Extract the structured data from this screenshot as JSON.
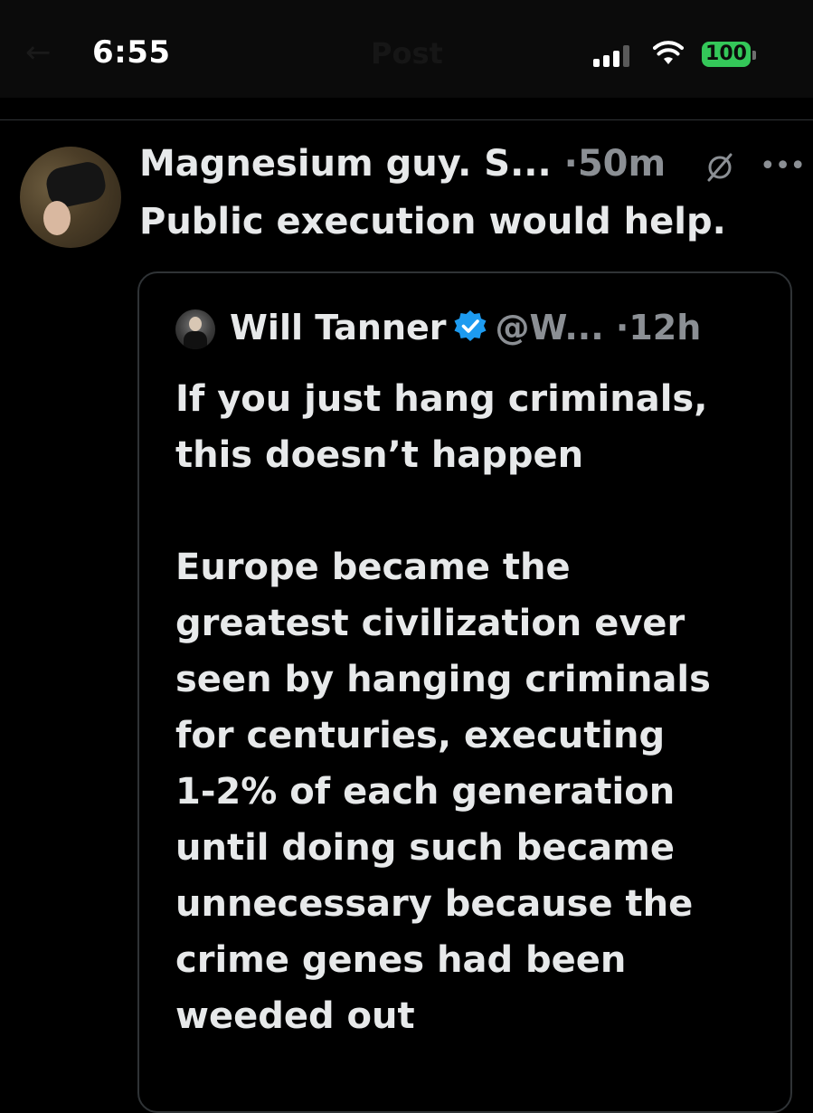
{
  "status_bar": {
    "time": "6:55",
    "battery": "100",
    "battery_color": "#34c759",
    "nav_back_glyph": "←",
    "nav_title": "Post"
  },
  "post": {
    "author_name": "Magnesium guy. S...",
    "separator": "·",
    "age": "50m",
    "text": "Public execution would help.",
    "icons": [
      "grok-icon",
      "more-icon"
    ]
  },
  "quote": {
    "author_name": "Will Tanner",
    "verified": true,
    "verified_color": "#1d9bf0",
    "handle": "@W...",
    "separator": "·",
    "age": "12h",
    "paragraphs": [
      [
        "If you just hang criminals,",
        "this doesn’t happen"
      ],
      [
        "Europe became the",
        "greatest civilization ever",
        "seen by hanging criminals",
        "for centuries, executing",
        "1-2% of each generation",
        "until doing such became",
        "unnecessary because the",
        "crime genes had been",
        "weeded out"
      ]
    ]
  }
}
